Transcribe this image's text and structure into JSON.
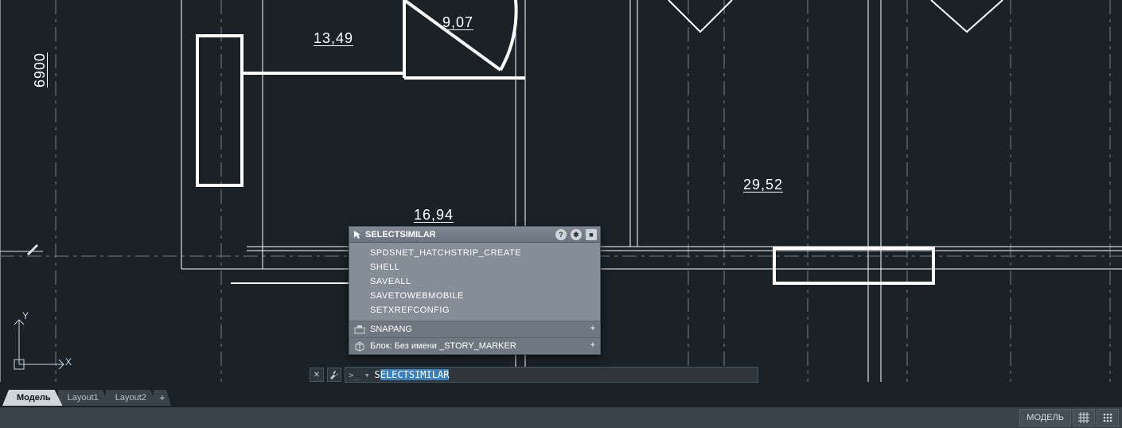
{
  "dimensions": {
    "d1": "13,49",
    "d2": "9,07",
    "d3": "29,52",
    "d4": "16,94",
    "v1": "6900"
  },
  "ucs": {
    "x": "X",
    "y": "Y"
  },
  "palette": {
    "title": "SELECTSIMILAR",
    "items": [
      "SPDSNET_HATCHSTRIP_CREATE",
      "SHELL",
      "SAVEALL",
      "SAVETOWEBMOBILE",
      "SETXREFCONFIG"
    ],
    "extra1": "SNAPANG",
    "extra2": "Блок: Без имени _STORY_MARKER"
  },
  "cmdline": {
    "prompt": ">_ ▾",
    "prefix": "S",
    "completion": "ELECTSIMILAR"
  },
  "tabs": {
    "model": "Модель",
    "layout1": "Layout1",
    "layout2": "Layout2"
  },
  "status": {
    "model_btn": "МОДЕЛЬ"
  }
}
